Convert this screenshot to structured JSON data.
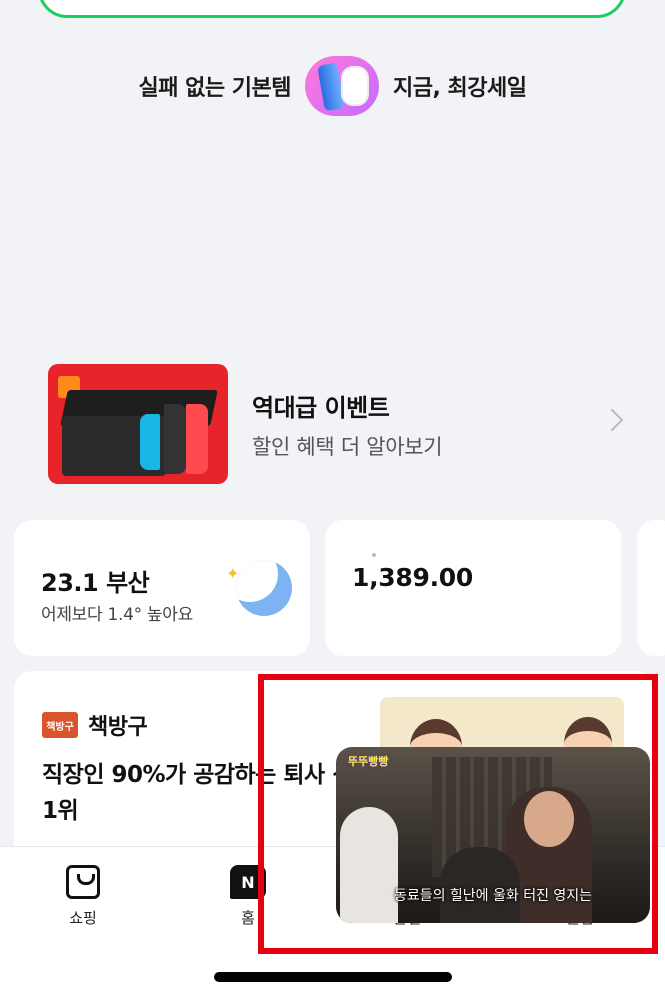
{
  "promo": {
    "left_text": "실패 없는 기본템",
    "right_text": "지금, 최강세일"
  },
  "event": {
    "title": "역대급 이벤트",
    "subtitle": "할인 혜택 더 알아보기"
  },
  "weather": {
    "temp_city": "23.1 부산",
    "compare": "어제보다 1.4° 높아요",
    "icon": "crescent-moon-icon"
  },
  "stock": {
    "value": "1,389.00"
  },
  "book": {
    "brand_logo": "책방구",
    "brand": "책방구",
    "title": "직장인 90%가 공감하는 퇴사 신호 1위"
  },
  "pip_video": {
    "show_logo": "뚜뚜빵빵",
    "caption": "동료들의 힐난에 울화 터진 영지는"
  },
  "tabbar": {
    "items": [
      {
        "label": "쇼핑",
        "icon": "shopping-bag-icon"
      },
      {
        "label": "홈",
        "icon": "naver-n-icon"
      },
      {
        "label": "콘텐츠",
        "icon": "content-icon"
      },
      {
        "label": "클립",
        "icon": "clip-icon"
      }
    ]
  },
  "colors": {
    "highlight": "#e60012",
    "search_border": "#19ce60"
  }
}
